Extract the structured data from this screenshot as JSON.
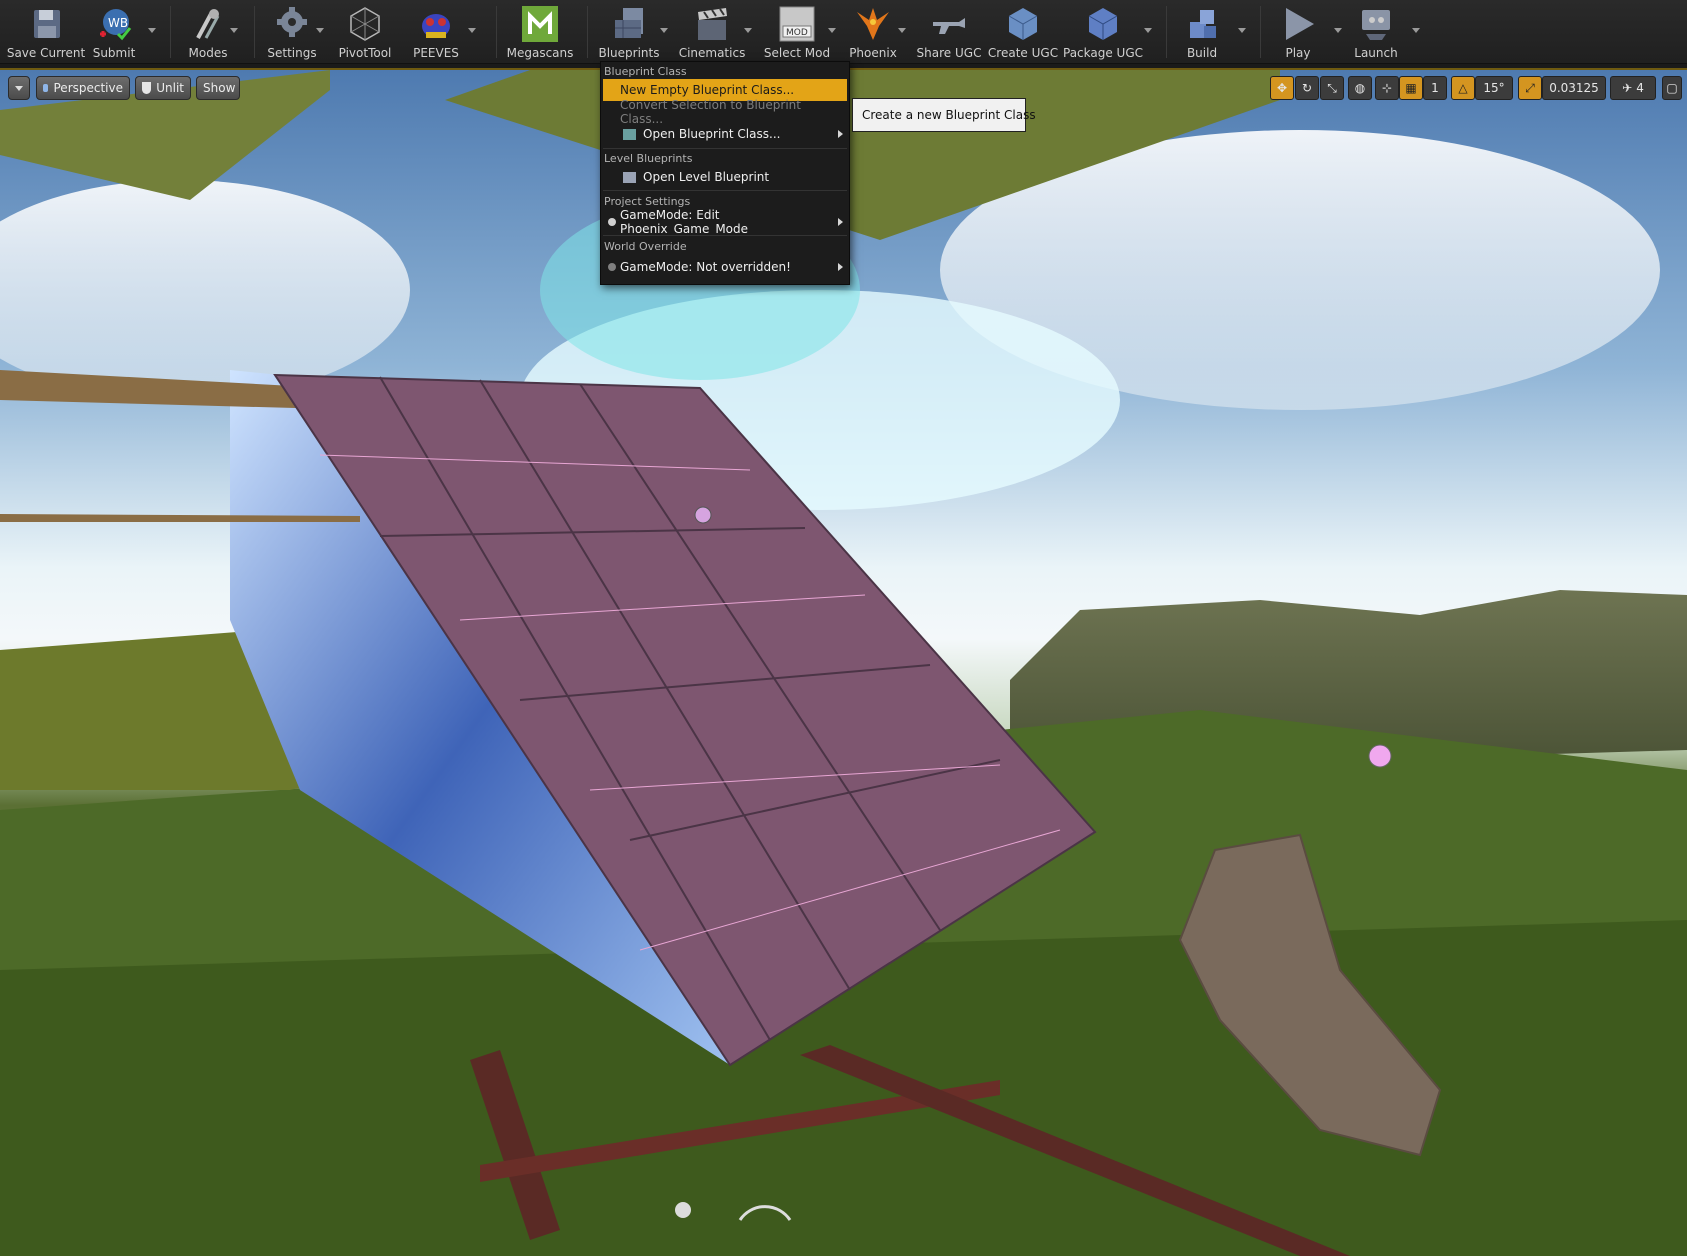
{
  "toolbar": {
    "buttons": [
      {
        "label": "Save Current",
        "icon": "save-icon"
      },
      {
        "label": "Submit",
        "icon": "source-control-icon"
      },
      {
        "label": "Modes",
        "icon": "modes-icon"
      },
      {
        "label": "Settings",
        "icon": "settings-icon"
      },
      {
        "label": "PivotTool",
        "icon": "pivot-tool-icon"
      },
      {
        "label": "PEEVES",
        "icon": "peeves-icon"
      },
      {
        "label": "Megascans",
        "icon": "megascans-icon"
      },
      {
        "label": "Blueprints",
        "icon": "blueprints-icon"
      },
      {
        "label": "Cinematics",
        "icon": "cinematics-icon"
      },
      {
        "label": "Select Mod",
        "icon": "mod-icon",
        "icon_text": "MOD"
      },
      {
        "label": "Phoenix",
        "icon": "phoenix-icon"
      },
      {
        "label": "Share UGC",
        "icon": "share-ugc-icon"
      },
      {
        "label": "Create UGC",
        "icon": "create-ugc-icon"
      },
      {
        "label": "Package UGC",
        "icon": "package-ugc-icon"
      },
      {
        "label": "Build",
        "icon": "build-icon"
      },
      {
        "label": "Play",
        "icon": "play-icon"
      },
      {
        "label": "Launch",
        "icon": "launch-icon"
      }
    ]
  },
  "viewport": {
    "view_mode": "Perspective",
    "lighting": "Unlit",
    "show": "Show",
    "rotation_snap": "15°",
    "scale_snap": "0.03125",
    "grid_snap": "1",
    "camera_speed": "4"
  },
  "blueprints_menu": {
    "sections": {
      "blueprint_class": "Blueprint Class",
      "level_blueprints": "Level Blueprints",
      "project_settings": "Project Settings",
      "world_override": "World Override"
    },
    "items": {
      "new_empty": "New Empty Blueprint Class...",
      "convert_selection": "Convert Selection to Blueprint Class...",
      "open_class": "Open Blueprint Class...",
      "open_level": "Open Level Blueprint",
      "gamemode_edit": "GameMode: Edit Phoenix_Game_Mode",
      "gamemode_override": "GameMode: Not overridden!"
    },
    "tooltip": "Create a new Blueprint Class"
  },
  "colors": {
    "menu_highlight": "#e3a417",
    "roof_surface": "#7e5670",
    "grass": "#5b7034"
  }
}
